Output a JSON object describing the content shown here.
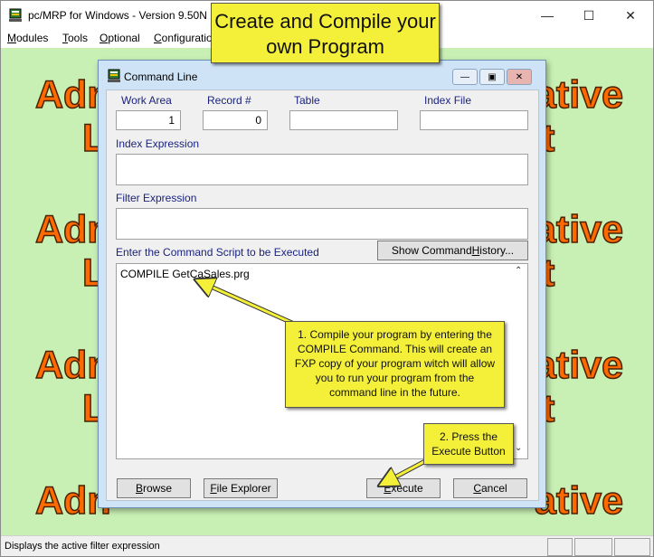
{
  "app": {
    "title": "pc/MRP for Windows - Version 9.50N",
    "menus": [
      {
        "label": "Modules",
        "underline": "M",
        "rest": "odules"
      },
      {
        "label": "Tools",
        "underline": "T",
        "rest": "ools"
      },
      {
        "label": "Optional",
        "underline": "O",
        "rest": "ptional"
      },
      {
        "label": "Configuration",
        "underline": "C",
        "rest": "onfiguratio"
      }
    ]
  },
  "watermark": {
    "line1_left": "Adn",
    "line1_right": "ative",
    "line2_left": "L",
    "line2_right": "t"
  },
  "status": {
    "text": "Displays the active filter expression"
  },
  "dialog": {
    "title": "Command Line",
    "work_area_label": "Work Area",
    "work_area_value": "1",
    "record_label": "Record #",
    "record_value": "0",
    "table_label": "Table",
    "table_value": "",
    "index_file_label": "Index File",
    "index_file_value": "",
    "index_expr_label": "Index Expression",
    "index_expr_value": "",
    "filter_expr_label": "Filter Expression",
    "filter_expr_value": "",
    "script_label": "Enter the Command Script to be Executed",
    "history_button": {
      "pre": "Show Command ",
      "u": "H",
      "post": "istory..."
    },
    "script_text": "COMPILE GetCaSales.prg",
    "buttons": {
      "browse": {
        "u": "B",
        "rest": "rowse"
      },
      "explorer": {
        "u": "F",
        "rest": "ile Explorer"
      },
      "execute": {
        "u": "E",
        "rest": "xecute"
      },
      "cancel": {
        "u": "C",
        "rest": "ancel"
      }
    }
  },
  "callouts": {
    "header": "Create and Compile your own Program",
    "step1": "1. Compile your program by entering the COMPILE Command.  This will create an FXP copy of your program witch will allow you to run your program from the command line in the future.",
    "step2": "2. Press the Execute Button"
  }
}
